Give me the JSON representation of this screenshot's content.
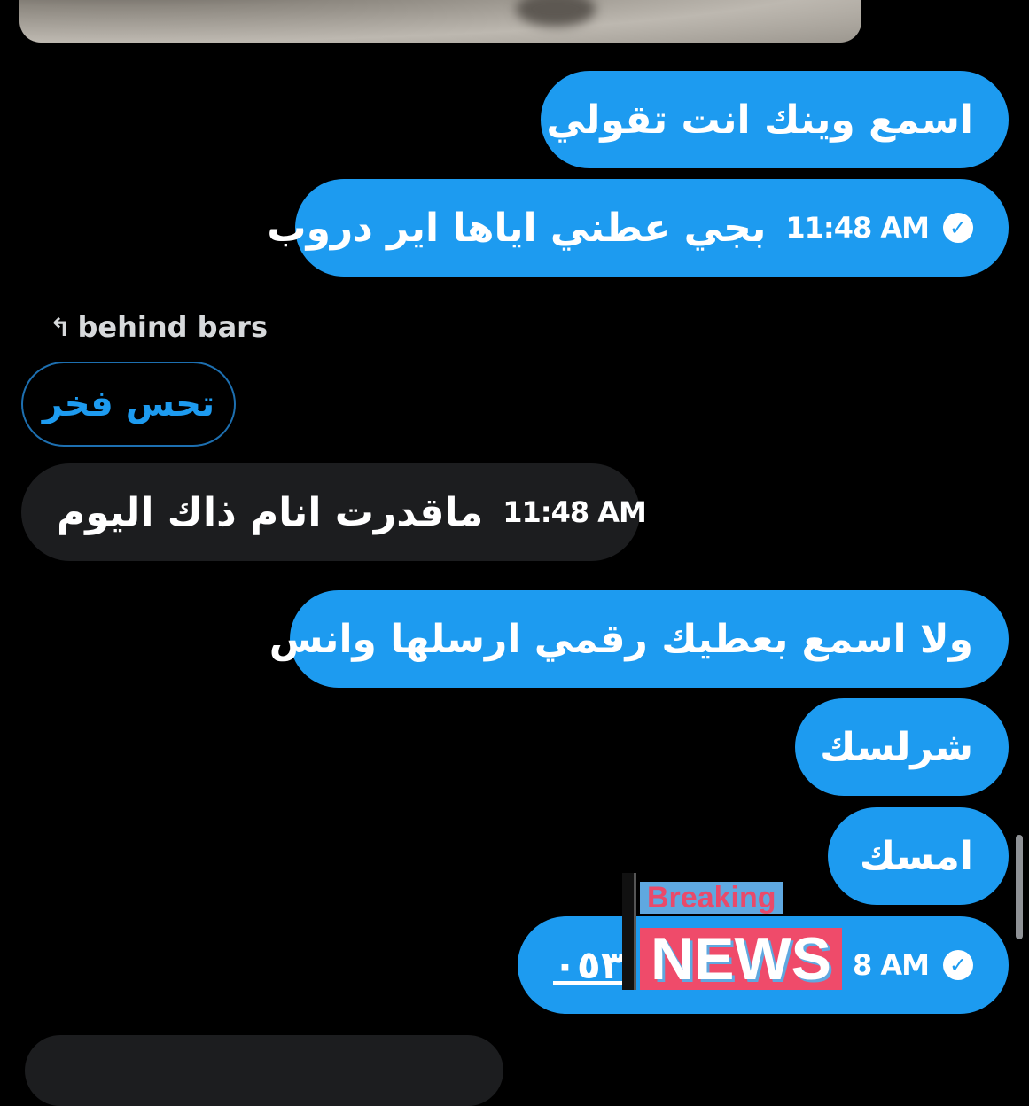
{
  "messages": {
    "m1": {
      "text": "اسمع وينك انت تقولي"
    },
    "m2": {
      "text": "بجي عطني اياها اير دروب",
      "time": "11:48 AM"
    },
    "reply": {
      "label": "behind bars",
      "quote": "تحس فخر"
    },
    "m3": {
      "text": "ماقدرت انام ذاك اليوم",
      "time": "11:48 AM"
    },
    "m4": {
      "text": "ولا اسمع بعطيك رقمي ارسلها وانس"
    },
    "m5": {
      "text": "شرلسك"
    },
    "m6": {
      "text": "امسك"
    },
    "m7": {
      "text": "٠٥٣",
      "time": "8 AM"
    }
  },
  "overlay": {
    "breaking": "Breaking",
    "news": "NEWS"
  },
  "icons": {
    "check": "✓",
    "reply": "↰"
  },
  "colors": {
    "accent": "#1d9bf0",
    "background": "#000000",
    "received_bubble": "#1c1d1f"
  }
}
